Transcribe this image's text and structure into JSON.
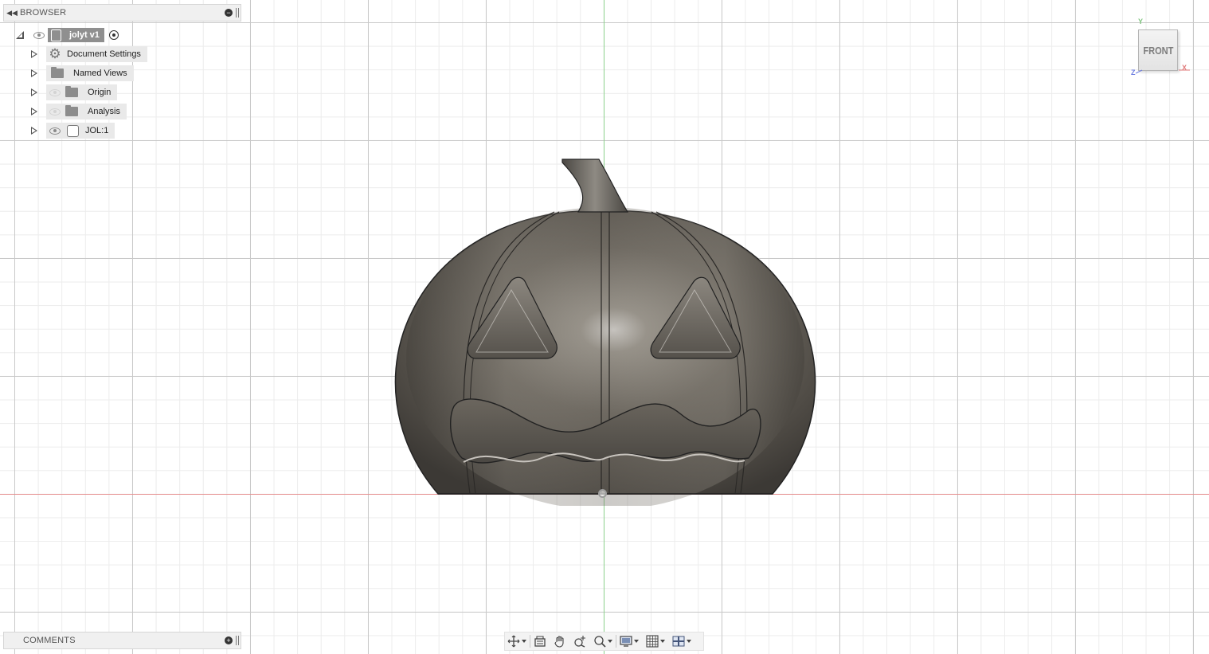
{
  "browser": {
    "title": "BROWSER",
    "root": {
      "label": "jolyt v1"
    },
    "items": [
      {
        "label": "Document Settings",
        "icon": "gear-icon",
        "visibility": "none"
      },
      {
        "label": "Named Views",
        "icon": "folder-icon",
        "visibility": "none"
      },
      {
        "label": "Origin",
        "icon": "folder-icon",
        "visibility": "hidden"
      },
      {
        "label": "Analysis",
        "icon": "folder-icon",
        "visibility": "hidden"
      },
      {
        "label": "JOL:1",
        "icon": "component-icon",
        "visibility": "visible"
      }
    ]
  },
  "comments": {
    "title": "COMMENTS"
  },
  "viewcube": {
    "face": "FRONT",
    "axis_y": "Y",
    "axis_x": "X",
    "axis_z": "Z"
  },
  "toolbar": {
    "buttons": [
      "orbit-icon",
      "look-at-icon",
      "pan-icon",
      "zoom-icon",
      "fit-icon",
      "display-settings-icon",
      "grid-icon",
      "viewports-icon"
    ]
  },
  "colors": {
    "grid_major": "#c9c9c9",
    "grid_minor": "#ececec",
    "axis_y": "#8ed28e",
    "axis_x": "#e58f8f",
    "model": "#6e6a63"
  }
}
